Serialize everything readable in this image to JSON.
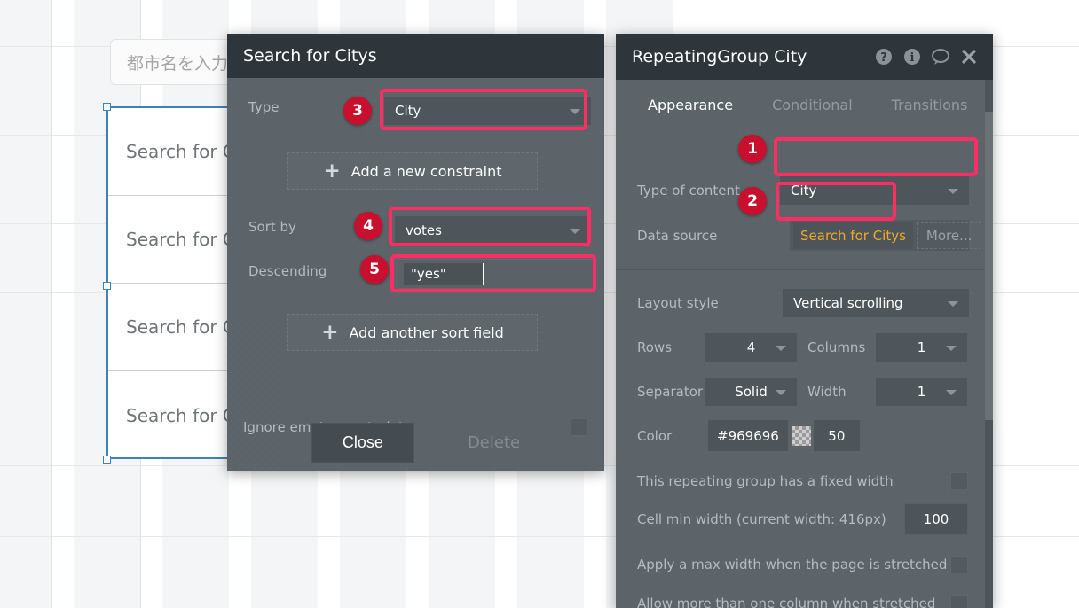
{
  "canvas": {
    "input_placeholder": "都市名を入力",
    "repeating_group_cells": [
      "Search for Citys",
      "Search for Citys",
      "Search for Citys",
      "Search for Citys"
    ]
  },
  "search_dialog": {
    "title": "Search for Citys",
    "type_label": "Type",
    "type_value": "City",
    "add_constraint_label": "Add a new constraint",
    "sort_by_label": "Sort by",
    "sort_by_value": "votes",
    "descending_label": "Descending",
    "descending_value": "\"yes\"",
    "add_sort_field_label": "Add another sort field",
    "ignore_empty_label": "Ignore empty constraints",
    "close_label": "Close",
    "delete_label": "Delete",
    "plus_glyph": "+",
    "caret_glyph": "▼"
  },
  "panel": {
    "title": "RepeatingGroup City",
    "icons": {
      "help": "?",
      "info": "i",
      "comment": "comment-bubble",
      "close": "✕"
    },
    "tabs": [
      {
        "label": "Appearance",
        "active": true
      },
      {
        "label": "Conditional",
        "active": false
      },
      {
        "label": "Transitions",
        "active": false
      }
    ],
    "fields": {
      "type_of_content_label": "Type of content",
      "type_of_content_value": "City",
      "data_source_label": "Data source",
      "data_source_value": "Search for Citys",
      "data_source_more": "More...",
      "layout_style_label": "Layout style",
      "layout_style_value": "Vertical scrolling",
      "rows_label": "Rows",
      "rows_value": "4",
      "columns_label": "Columns",
      "columns_value": "1",
      "separator_label": "Separator",
      "separator_value": "Solid",
      "width_label": "Width",
      "width_value": "1",
      "color_label": "Color",
      "color_hex": "#969696",
      "color_opacity": "50",
      "fixed_width_label": "This repeating group has a fixed width",
      "cell_min_width_label": "Cell min width (current width: 416px)",
      "cell_min_width_value": "100",
      "max_width_label": "Apply a max width when the page is stretched",
      "allow_columns_label": "Allow more than one column when stretched"
    }
  },
  "annotations": {
    "badges": [
      {
        "num": "1",
        "target": "type-of-content"
      },
      {
        "num": "2",
        "target": "data-source"
      },
      {
        "num": "3",
        "target": "search-type"
      },
      {
        "num": "4",
        "target": "sort-by"
      },
      {
        "num": "5",
        "target": "descending"
      }
    ],
    "highlight_color": "#ff2d64",
    "badge_color": "#c8102e"
  }
}
